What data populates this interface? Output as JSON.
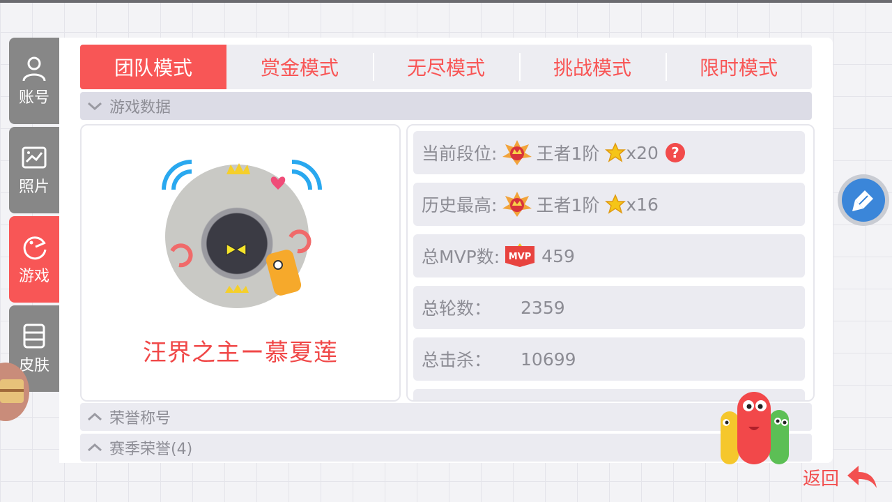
{
  "nav": {
    "items": [
      {
        "label": "账号",
        "icon": "person-icon"
      },
      {
        "label": "照片",
        "icon": "photo-icon"
      },
      {
        "label": "游戏",
        "icon": "game-icon"
      },
      {
        "label": "皮肤",
        "icon": "skin-icon"
      }
    ],
    "active": "游戏"
  },
  "tabs": {
    "items": [
      "团队模式",
      "赏金模式",
      "无尽模式",
      "挑战模式",
      "限时模式"
    ],
    "active": "团队模式"
  },
  "sections": {
    "game_data": "游戏数据",
    "honor_title": "荣誉称号",
    "season_honor": "赛季荣誉(4)"
  },
  "profile": {
    "nickname": "汪界之主ー慕夏莲"
  },
  "stats": {
    "current_rank": {
      "label": "当前段位:",
      "rank": "王者1阶",
      "stars": "x20"
    },
    "best_rank": {
      "label": "历史最高:",
      "rank": "王者1阶",
      "stars": "x16"
    },
    "mvp": {
      "label": "总MVP数:",
      "badge": "MVP",
      "value": "459"
    },
    "rounds": {
      "label": "总轮数：",
      "value": "2359"
    },
    "kills": {
      "label": "总击杀：",
      "value": "10699"
    }
  },
  "help_glyph": "?",
  "back": {
    "label": "返回"
  },
  "colors": {
    "accent": "#f85656",
    "nav_inactive": "#878787",
    "blue_button": "#3b86d9"
  }
}
